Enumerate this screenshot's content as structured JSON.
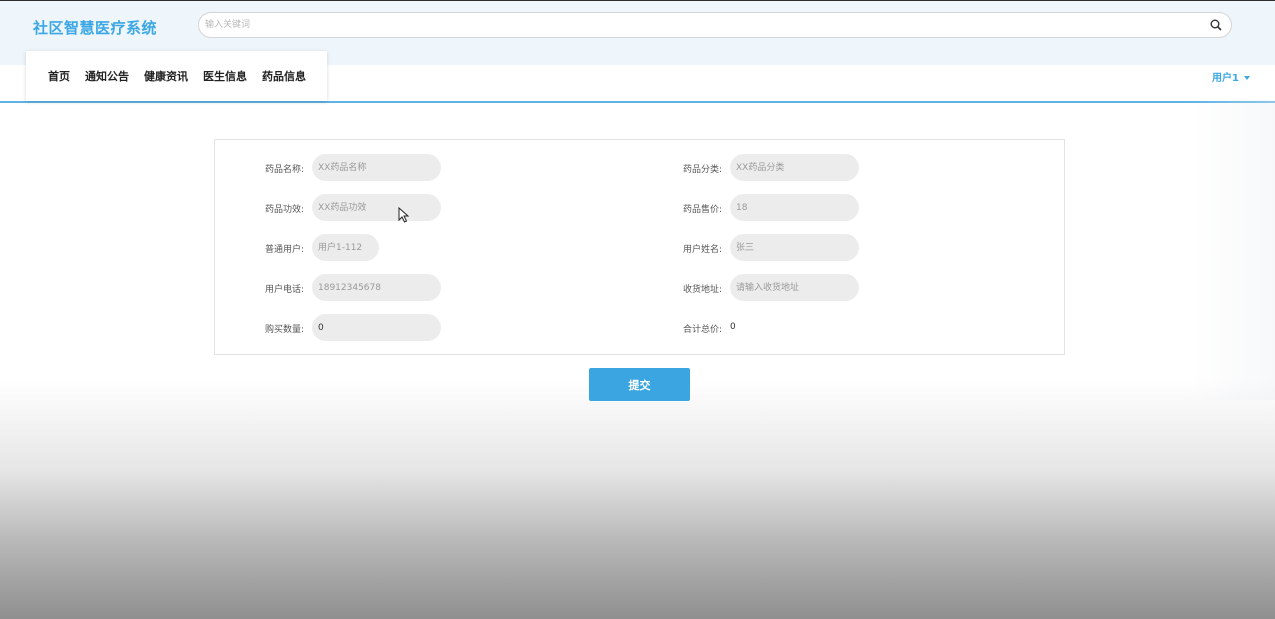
{
  "header": {
    "logo": "社区智慧医疗系统",
    "search": {
      "placeholder": "输入关键词",
      "value": ""
    },
    "search_icon": "search-icon"
  },
  "nav": {
    "items": [
      {
        "label": "首页"
      },
      {
        "label": "通知公告"
      },
      {
        "label": "健康资讯"
      },
      {
        "label": "医生信息"
      },
      {
        "label": "药品信息"
      }
    ],
    "user_menu": "用户1",
    "user_menu_icon": "caret-down-icon"
  },
  "form": {
    "drug_name": {
      "label": "药品名称:",
      "placeholder": "XX药品名称",
      "value": ""
    },
    "drug_category": {
      "label": "药品分类:",
      "placeholder": "XX药品分类",
      "value": ""
    },
    "drug_efficacy": {
      "label": "药品功效:",
      "placeholder": "XX药品功效",
      "value": ""
    },
    "drug_price": {
      "label": "药品售价:",
      "placeholder": "18",
      "value": ""
    },
    "regular_user": {
      "label": "普通用户:",
      "placeholder": "用户1-112",
      "value": ""
    },
    "user_name": {
      "label": "用户姓名:",
      "placeholder": "张三",
      "value": ""
    },
    "user_phone": {
      "label": "用户电话:",
      "placeholder": "18912345678",
      "value": ""
    },
    "shipping_address": {
      "label": "收货地址:",
      "placeholder": "请输入收货地址",
      "value": ""
    },
    "purchase_quantity": {
      "label": "购买数量:",
      "value": "0"
    },
    "total_price": {
      "label": "合计总价:",
      "value": "0"
    },
    "submit_label": "提交"
  },
  "colors": {
    "accent": "#3aa5e0",
    "header_bg": "#eef5fb",
    "field_bg": "#ececec"
  }
}
